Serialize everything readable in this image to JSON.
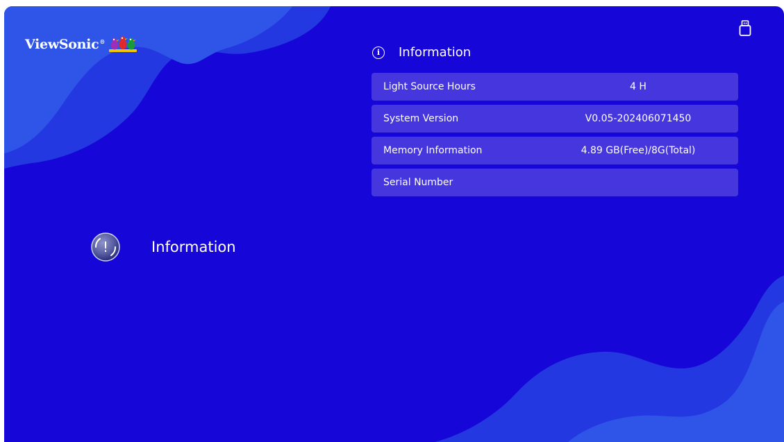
{
  "brand": {
    "name": "ViewSonic",
    "trademark": "®",
    "logo_icon": "three-birds-logo"
  },
  "status": {
    "usb_icon": "usb-drive-icon"
  },
  "panel": {
    "icon": "info-circle-icon",
    "icon_glyph": "i",
    "title": "Information",
    "rows": [
      {
        "label": "Light Source Hours",
        "value": "4 H"
      },
      {
        "label": "System Version",
        "value": "V0.05-202406071450"
      },
      {
        "label": "Memory Information",
        "value": "4.89 GB(Free)/8G(Total)"
      },
      {
        "label": "Serial Number",
        "value": ""
      }
    ]
  },
  "menu": {
    "selected": {
      "icon": "exclamation-circle-icon",
      "glyph": "!",
      "label": "Information"
    }
  },
  "colors": {
    "background": "#1606d8",
    "wave_light": "#2e55e8",
    "wave_mid": "#2338e0",
    "row_background": "#4536de",
    "text": "#ffffff"
  }
}
